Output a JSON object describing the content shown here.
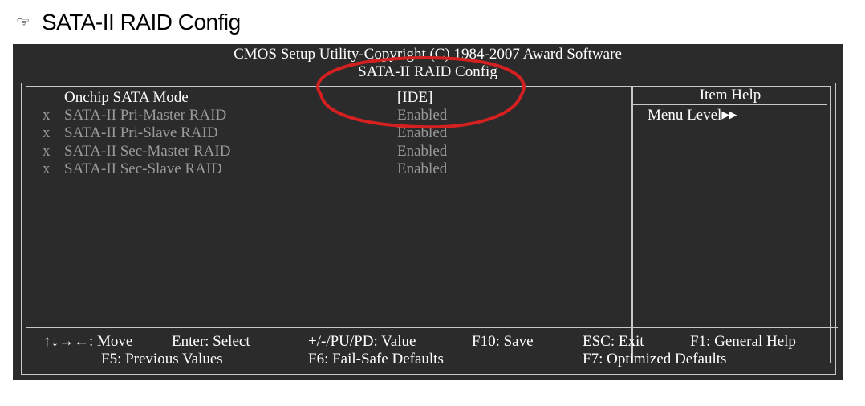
{
  "heading": {
    "icon": "pointing-hand-icon",
    "title": "SATA-II RAID Config"
  },
  "bios": {
    "header_line1": "CMOS Setup Utility-Copyright (C) 1984-2007 Award Software",
    "header_line2": "SATA-II RAID Config",
    "colors": {
      "background": "#2b2b2b",
      "text": "#ffffff",
      "disabled": "#9a9a9a",
      "annotation": "#d42020"
    },
    "settings": [
      {
        "mark": "",
        "label": "Onchip SATA Mode",
        "value": "[IDE]",
        "state": "active"
      },
      {
        "mark": "x",
        "label": "SATA-II Pri-Master RAID",
        "value": "Enabled",
        "state": "disabled"
      },
      {
        "mark": "x",
        "label": "SATA-II Pri-Slave RAID",
        "value": "Enabled",
        "state": "disabled"
      },
      {
        "mark": "x",
        "label": "SATA-II Sec-Master RAID",
        "value": "Enabled",
        "state": "disabled"
      },
      {
        "mark": "x",
        "label": "SATA-II Sec-Slave RAID",
        "value": "Enabled",
        "state": "disabled"
      }
    ],
    "help": {
      "title": "Item Help",
      "menu_level": "Menu Level",
      "menu_level_icon": "double-right-arrow-icon"
    },
    "footer": {
      "move": "↑↓→←: Move",
      "enter": "Enter: Select",
      "value": "+/-/PU/PD: Value",
      "save": "F10: Save",
      "esc": "ESC: Exit",
      "f1": "F1: General Help",
      "f5": "F5: Previous Values",
      "f6": "F6: Fail-Safe Defaults",
      "f7": "F7: Optimized Defaults"
    }
  }
}
